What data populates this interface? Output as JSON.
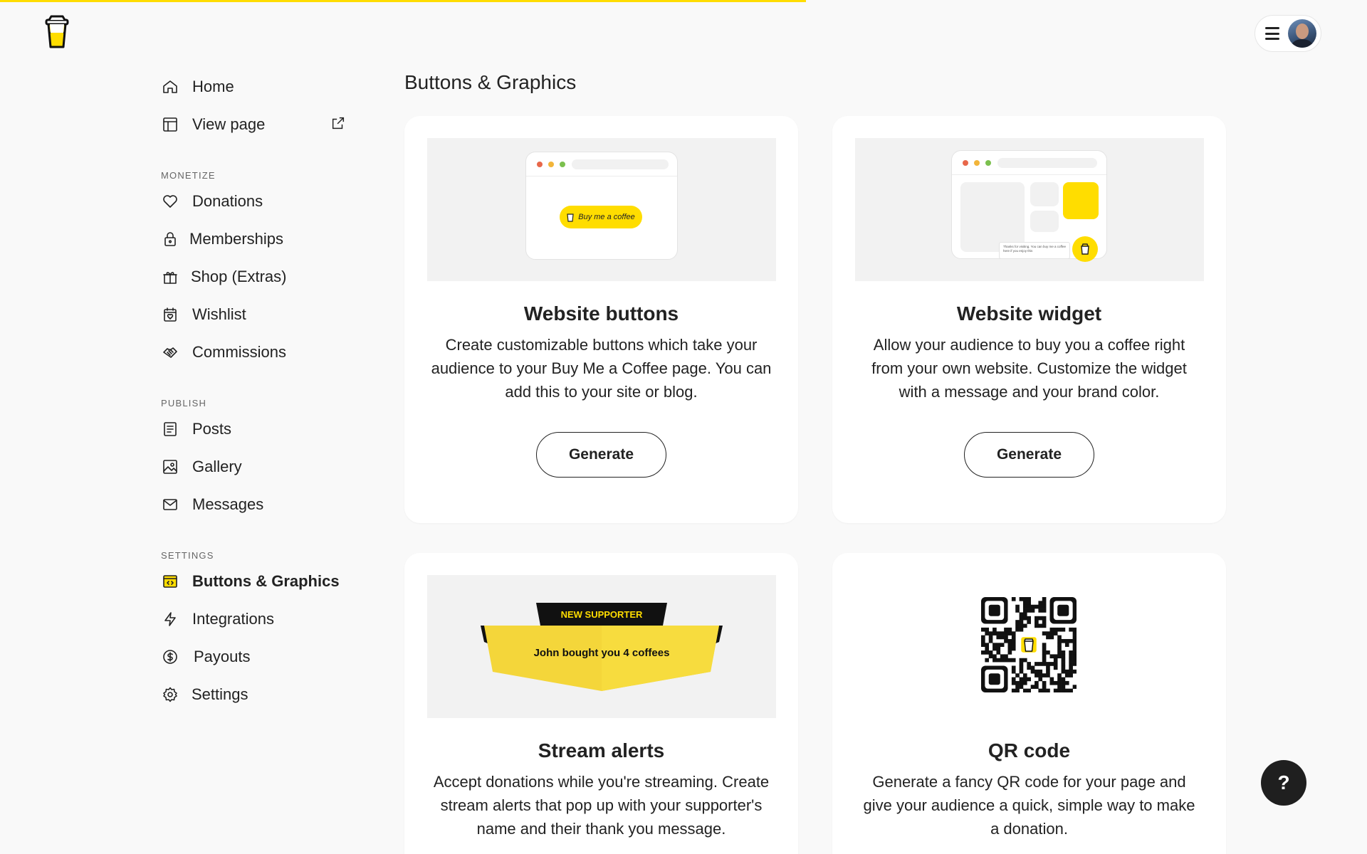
{
  "loading_progress_percent": 59,
  "brand": {
    "logo_icon": "coffee-cup-logo-icon",
    "accent": "#ffdd00"
  },
  "header": {
    "menu_icon": "hamburger-icon"
  },
  "sidebar": {
    "top_items": [
      {
        "label": "Home",
        "icon": "home-icon"
      },
      {
        "label": "View page",
        "icon": "layout-icon",
        "trailing_icon": "external-link-icon"
      }
    ],
    "sections": [
      {
        "title": "MONETIZE",
        "items": [
          {
            "label": "Donations",
            "icon": "heart-icon"
          },
          {
            "label": "Memberships",
            "icon": "lock-icon"
          },
          {
            "label": "Shop (Extras)",
            "icon": "gift-icon"
          },
          {
            "label": "Wishlist",
            "icon": "wishlist-icon"
          },
          {
            "label": "Commissions",
            "icon": "handshake-icon"
          }
        ]
      },
      {
        "title": "PUBLISH",
        "items": [
          {
            "label": "Posts",
            "icon": "document-icon"
          },
          {
            "label": "Gallery",
            "icon": "image-icon"
          },
          {
            "label": "Messages",
            "icon": "mail-icon"
          }
        ]
      },
      {
        "title": "SETTINGS",
        "items": [
          {
            "label": "Buttons & Graphics",
            "icon": "code-window-icon",
            "active": true
          },
          {
            "label": "Integrations",
            "icon": "lightning-icon"
          },
          {
            "label": "Payouts",
            "icon": "dollar-circle-icon"
          },
          {
            "label": "Settings",
            "icon": "gear-icon"
          }
        ]
      }
    ]
  },
  "main": {
    "title": "Buttons & Graphics",
    "cards": [
      {
        "title": "Website buttons",
        "description": "Create customizable buttons which take your audience to your Buy Me a Coffee page. You can add this to your site or blog.",
        "button": "Generate",
        "preview_button_text": "Buy me a coffee"
      },
      {
        "title": "Website widget",
        "description": "Allow your audience to buy you a coffee right from your own website. Customize the widget with a message and your brand color.",
        "button": "Generate",
        "preview_message": "Thanks for visiting. You can buy me a coffee here if you enjoy this"
      },
      {
        "title": "Stream alerts",
        "description": "Accept donations while you're streaming. Create stream alerts that pop up with your supporter's name and their thank you message.",
        "preview_banner_title": "NEW SUPPORTER",
        "preview_banner_text": "John bought you 4 coffees"
      },
      {
        "title": "QR code",
        "description": "Generate a fancy QR code for your page and give your audience a quick, simple way to make a donation.",
        "preview_icon": "qr-code-icon"
      }
    ]
  },
  "help": {
    "label": "?"
  }
}
